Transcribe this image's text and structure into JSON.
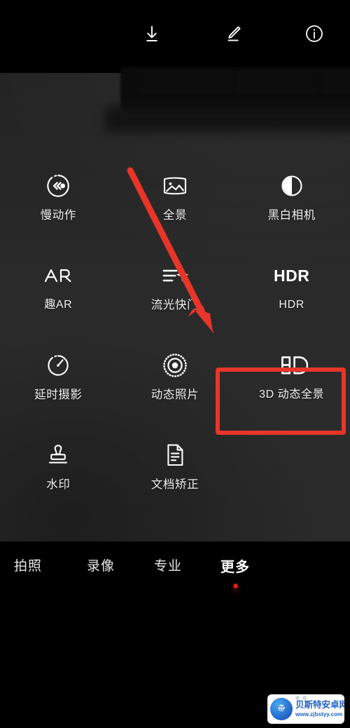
{
  "toolbar": {
    "icons": [
      {
        "name": "download-icon",
        "label": "下载"
      },
      {
        "name": "edit-icon",
        "label": "编辑"
      },
      {
        "name": "info-icon",
        "label": "详情"
      }
    ]
  },
  "mode_panel": {
    "modes": [
      {
        "icon": "slow-motion-icon",
        "icon_text": "",
        "label": "慢动作"
      },
      {
        "icon": "panorama-icon",
        "icon_text": "",
        "label": "全景"
      },
      {
        "icon": "monochrome-icon",
        "icon_text": "",
        "label": "黑白相机"
      },
      {
        "icon": "ar-icon",
        "icon_text": "AR",
        "label": "趣AR"
      },
      {
        "icon": "light-painting-icon",
        "icon_text": "",
        "label": "流光快门"
      },
      {
        "icon": "hdr-icon",
        "icon_text": "HDR",
        "label": "HDR"
      },
      {
        "icon": "time-lapse-icon",
        "icon_text": "",
        "label": "延时摄影"
      },
      {
        "icon": "live-photo-icon",
        "icon_text": "",
        "label": "动态照片"
      },
      {
        "icon": "three-d-icon",
        "icon_text": "3D",
        "label": "3D 动态全景"
      },
      {
        "icon": "watermark-icon",
        "icon_text": "",
        "label": "水印"
      },
      {
        "icon": "document-correction-icon",
        "icon_text": "",
        "label": "文档矫正"
      }
    ],
    "highlighted_mode": "3D 动态全景",
    "highlight_color": "#e8352a"
  },
  "annotation": {
    "arrow_color": "#e8352a",
    "points_to": "流光快门"
  },
  "tabbar": {
    "tabs": [
      {
        "label": "拍照",
        "active": false
      },
      {
        "label": "录像",
        "active": false
      },
      {
        "label": "专业",
        "active": false
      },
      {
        "label": "更多",
        "active": true
      }
    ],
    "indicator_color": "#e01b1b"
  },
  "watermark": {
    "title": "贝斯特安卓网",
    "url": "www.zjbstyy.com"
  }
}
